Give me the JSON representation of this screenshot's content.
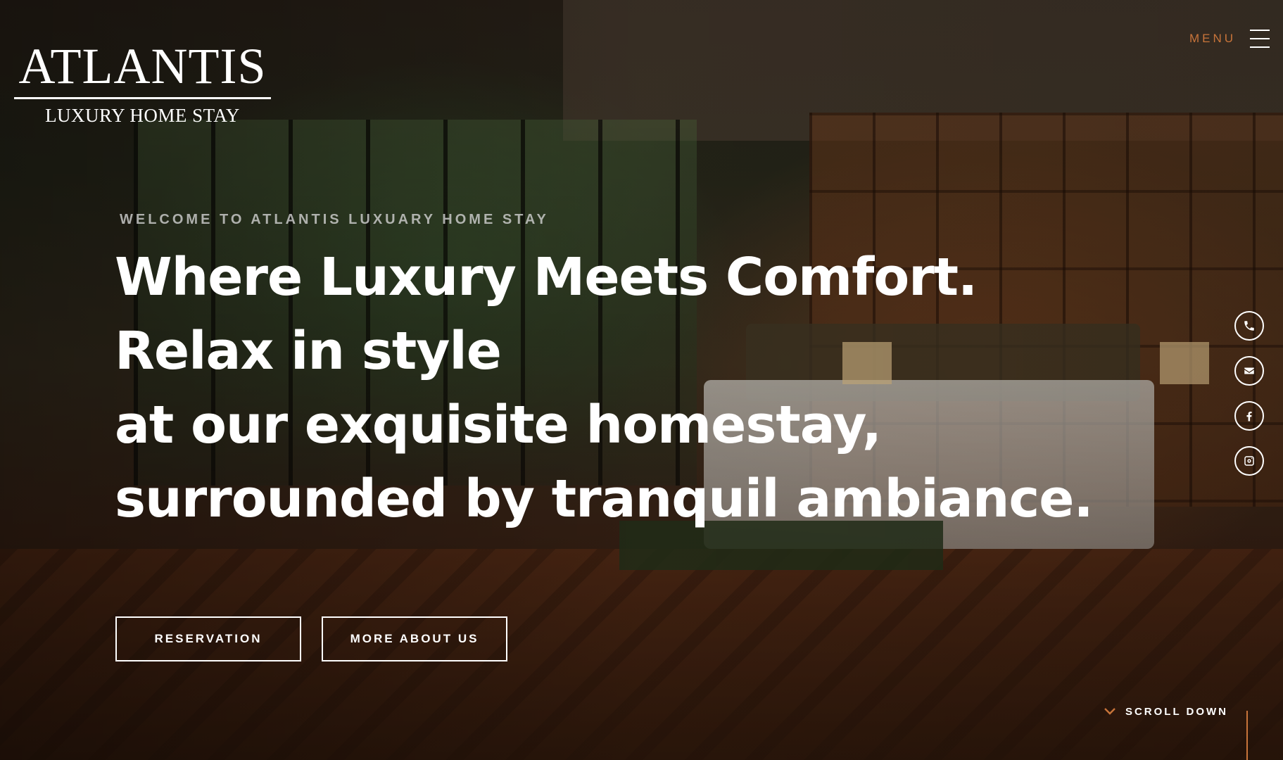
{
  "brand": {
    "title": "ATLANTIS",
    "subtitle": "LUXURY HOME STAY"
  },
  "menu": {
    "label": "MENU",
    "icon": "hamburger-icon"
  },
  "hero": {
    "eyebrow": "WELCOME TO ATLANTIS LUXUARY HOME STAY",
    "headline_lines": [
      "Where Luxury Meets Comfort.",
      "Relax in style",
      "at our exquisite homestay,",
      "surrounded by tranquil ambiance."
    ]
  },
  "buttons": {
    "reservation": "RESERVATION",
    "about": "MORE ABOUT US"
  },
  "social": [
    {
      "icon": "phone-icon"
    },
    {
      "icon": "email-icon"
    },
    {
      "icon": "facebook-icon"
    },
    {
      "icon": "instagram-icon"
    }
  ],
  "scroll": {
    "label": "SCROLL DOWN",
    "icon": "chevron-down-icon"
  },
  "colors": {
    "accent": "#c8743a",
    "text": "#ffffff"
  }
}
